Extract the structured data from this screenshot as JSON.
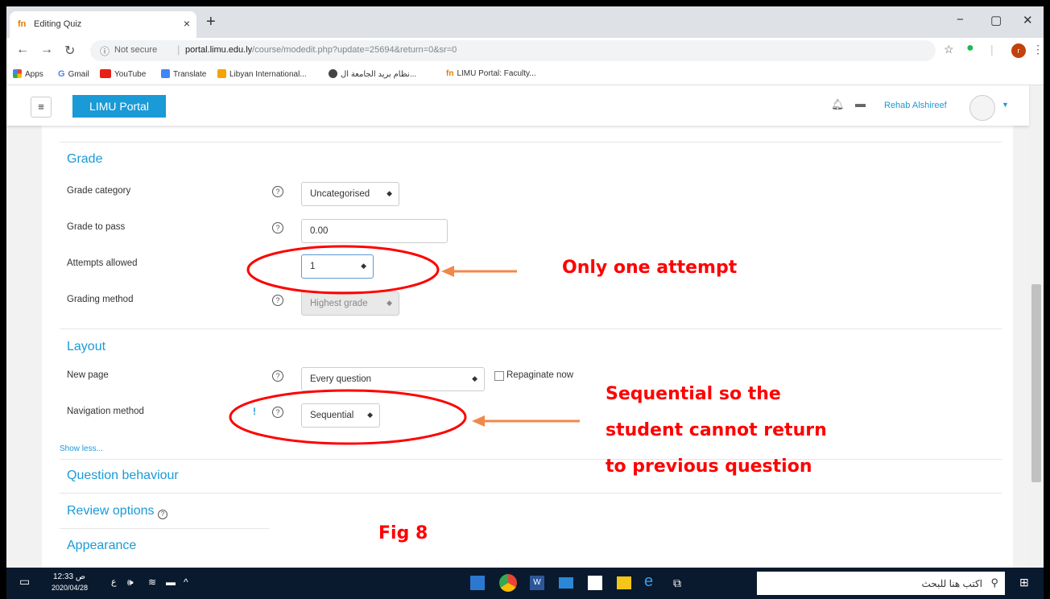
{
  "browser": {
    "tab_title": "Editing Quiz",
    "tab_icon": "fn",
    "new_tab": "+",
    "min": "−",
    "max": "▢",
    "close": "✕",
    "security_label": "Not secure",
    "url_host": "portal.limu.edu.ly",
    "url_path": "/course/modedit.php?update=25694&return=0&sr=0",
    "profile_initial": "r"
  },
  "bookmarks": {
    "apps": "Apps",
    "gmail": "Gmail",
    "youtube": "YouTube",
    "translate": "Translate",
    "libyan": "Libyan International...",
    "arabic": "نظام بريد الجامعة ال...",
    "limu": "LIMU Portal: Faculty..."
  },
  "moodle_nav": {
    "menu_icon": "≡",
    "brand": "LIMU Portal",
    "user_name": "Rehab Alshireef"
  },
  "grade": {
    "heading": "Grade",
    "grade_category_label": "Grade category",
    "grade_category_value": "Uncategorised",
    "grade_to_pass_label": "Grade to pass",
    "grade_to_pass_value": "0.00",
    "attempts_label": "Attempts allowed",
    "attempts_value": "1",
    "grading_method_label": "Grading method",
    "grading_method_value": "Highest grade"
  },
  "layout": {
    "heading": "Layout",
    "new_page_label": "New page",
    "new_page_value": "Every question",
    "repaginate_label": "Repaginate now",
    "navigation_label": "Navigation method",
    "navigation_value": "Sequential",
    "show_less": "Show less..."
  },
  "sections": {
    "question_behaviour": "Question behaviour",
    "review_options": "Review options",
    "appearance": "Appearance"
  },
  "annotations": {
    "one_attempt": "Only one attempt",
    "sequential_1": "Sequential so the",
    "sequential_2": "student cannot return",
    "sequential_3": "to previous question",
    "fig": "Fig 8"
  },
  "taskbar": {
    "time": "12:33 ص",
    "date": "2020/04/28",
    "search_placeholder": "اكتب هنا للبحث"
  }
}
